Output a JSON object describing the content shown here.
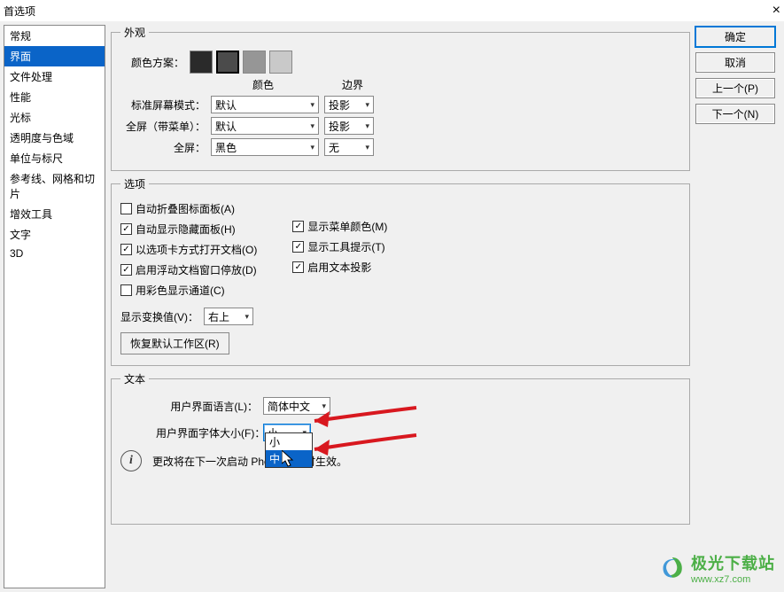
{
  "window": {
    "title": "首选项",
    "close": "×"
  },
  "sidebar": {
    "items": [
      {
        "label": "常规"
      },
      {
        "label": "界面"
      },
      {
        "label": "文件处理"
      },
      {
        "label": "性能"
      },
      {
        "label": "光标"
      },
      {
        "label": "透明度与色域"
      },
      {
        "label": "单位与标尺"
      },
      {
        "label": "参考线、网格和切片"
      },
      {
        "label": "增效工具"
      },
      {
        "label": "文字"
      },
      {
        "label": "3D"
      }
    ],
    "active_index": 1
  },
  "buttons": {
    "ok": "确定",
    "cancel": "取消",
    "prev": "上一个(P)",
    "next": "下一个(N)"
  },
  "appearance": {
    "legend": "外观",
    "color_scheme_label": "颜色方案：",
    "swatches": [
      "#2a2a2a",
      "#4b4b4b",
      "#969696",
      "#c9c9c9"
    ],
    "selected_swatch": 1,
    "col_color": "颜色",
    "col_border": "边界",
    "rows": [
      {
        "label": "标准屏幕模式：",
        "color": "默认",
        "border": "投影"
      },
      {
        "label": "全屏（带菜单）：",
        "color": "默认",
        "border": "投影"
      },
      {
        "label": "全屏：",
        "color": "黑色",
        "border": "无"
      }
    ]
  },
  "options": {
    "legend": "选项",
    "left": [
      {
        "label": "自动折叠图标面板(A)",
        "checked": false
      },
      {
        "label": "自动显示隐藏面板(H)",
        "checked": true
      },
      {
        "label": "以选项卡方式打开文档(O)",
        "checked": true
      },
      {
        "label": "启用浮动文档窗口停放(D)",
        "checked": true
      },
      {
        "label": "用彩色显示通道(C)",
        "checked": false
      }
    ],
    "right": [
      {
        "label": "显示菜单颜色(M)",
        "checked": true
      },
      {
        "label": "显示工具提示(T)",
        "checked": true
      },
      {
        "label": "启用文本投影",
        "checked": true
      }
    ],
    "transform_label": "显示变换值(V)：",
    "transform_value": "右上",
    "reset_btn": "恢复默认工作区(R)"
  },
  "text": {
    "legend": "文本",
    "lang_label": "用户界面语言(L)：",
    "lang_value": "简体中文",
    "size_label": "用户界面字体大小(F)：",
    "size_value": "小",
    "dropdown_options": [
      "小",
      "中"
    ],
    "dropdown_highlight": 1,
    "note": "更改将在下一次启动 Photoshop 时生效。"
  },
  "watermark": {
    "brand": "极光下载站",
    "url": "www.xz7.com"
  }
}
